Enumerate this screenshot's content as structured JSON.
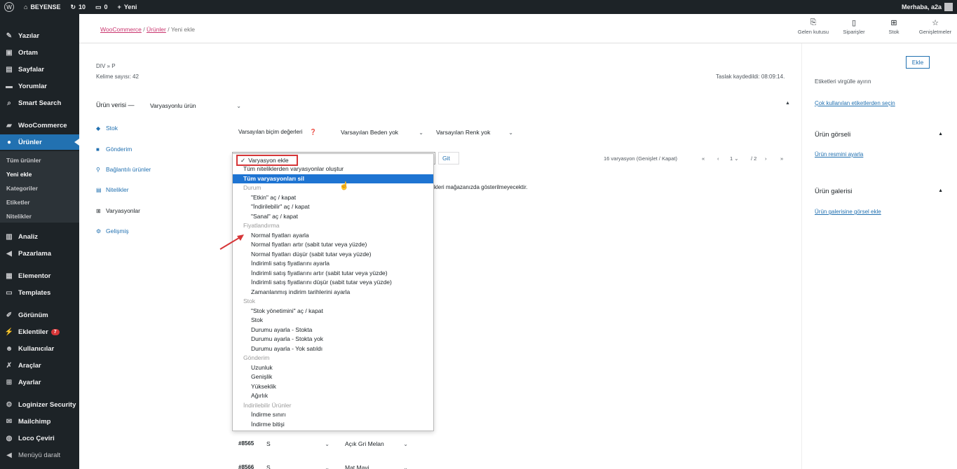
{
  "adminbar": {
    "site_name": "BEYENSE",
    "updates_count": "10",
    "comments_count": "0",
    "new_label": "Yeni",
    "greeting": "Merhaba, a2a"
  },
  "sidebar": {
    "items": [
      {
        "label": "Yazılar",
        "icon": "pin-icon"
      },
      {
        "label": "Ortam",
        "icon": "media-icon"
      },
      {
        "label": "Sayfalar",
        "icon": "page-icon"
      },
      {
        "label": "Yorumlar",
        "icon": "comment-icon"
      },
      {
        "label": "Smart Search",
        "icon": "search-icon"
      },
      {
        "label": "WooCommerce",
        "icon": "woo-icon"
      },
      {
        "label": "Ürünler",
        "icon": "products-icon"
      },
      {
        "label": "Analiz",
        "icon": "chart-icon"
      },
      {
        "label": "Pazarlama",
        "icon": "megaphone-icon"
      },
      {
        "label": "Elementor",
        "icon": "elementor-icon"
      },
      {
        "label": "Templates",
        "icon": "folder-icon"
      },
      {
        "label": "Görünüm",
        "icon": "brush-icon"
      },
      {
        "label": "Eklentiler",
        "icon": "plugin-icon",
        "badge": "7"
      },
      {
        "label": "Kullanıcılar",
        "icon": "user-icon"
      },
      {
        "label": "Araçlar",
        "icon": "wrench-icon"
      },
      {
        "label": "Ayarlar",
        "icon": "settings-icon"
      },
      {
        "label": "Loginizer Security",
        "icon": "gear-icon"
      },
      {
        "label": "Mailchimp",
        "icon": "mailchimp-icon"
      },
      {
        "label": "Loco Çeviri",
        "icon": "globe-icon"
      },
      {
        "label": "Menüyü daralt",
        "icon": "collapse-icon"
      }
    ],
    "submenu": [
      "Tüm ürünler",
      "Yeni ekle",
      "Kategoriler",
      "Etiketler",
      "Nitelikler"
    ]
  },
  "topbar": {
    "breadcrumb": [
      "WooCommerce",
      "Ürünler",
      "Yeni ekle"
    ],
    "actions": [
      {
        "label": "Gelen kutusu",
        "icon": "inbox-icon"
      },
      {
        "label": "Siparişler",
        "icon": "orders-icon"
      },
      {
        "label": "Stok",
        "icon": "stock-icon"
      },
      {
        "label": "Genişletmeler",
        "icon": "star-icon"
      }
    ]
  },
  "editor": {
    "path": "DIV » P",
    "word_count": "Kelime sayısı: 42",
    "draft_saved": "Taslak kaydedildi: 08:09:14."
  },
  "product_data": {
    "label": "Ürün verisi —",
    "type_value": "Varyasyonlu ürün",
    "default_values_label": "Varsayılan biçim değerleri",
    "default_size": "Varsayılan Beden yok",
    "default_color": "Varsayılan Renk yok",
    "go_button": "Git",
    "pagination": "16 varyasyon (Genişlet / Kapat)",
    "page_current": "1",
    "page_total": "/ 2",
    "notice_fragment": "kleri mağazanızda gösterilmeyecektir.",
    "tabs": [
      "Stok",
      "Gönderim",
      "Bağlantılı ürünler",
      "Nitelikler",
      "Varyasyonlar",
      "Gelişmiş"
    ],
    "variation_rows": [
      {
        "id": "#8565",
        "size": "S",
        "color": "Açık Gri Melan"
      },
      {
        "id": "#8566",
        "size": "S",
        "color": "Mat Mavi"
      }
    ]
  },
  "dropdown": {
    "selected": "Varyasyon ekle",
    "options": [
      {
        "text": "Tüm niteliklerden varyasyonlar oluştur",
        "kind": "option"
      },
      {
        "text": "Tüm varyasyonları sil",
        "kind": "highlight"
      },
      {
        "text": "Durum",
        "kind": "group"
      },
      {
        "text": "\"Etkin\" aç / kapat",
        "kind": "indent"
      },
      {
        "text": "\"İndirilebilir\" aç / kapat",
        "kind": "indent"
      },
      {
        "text": "\"Sanal\" aç / kapat",
        "kind": "indent"
      },
      {
        "text": "Fiyatlandırma",
        "kind": "group"
      },
      {
        "text": "Normal fiyatları ayarla",
        "kind": "indent"
      },
      {
        "text": "Normal fiyatları artır (sabit tutar veya yüzde)",
        "kind": "indent"
      },
      {
        "text": "Normal fiyatları düşür (sabit tutar veya yüzde)",
        "kind": "indent"
      },
      {
        "text": "İndirimli satış fiyatlarını ayarla",
        "kind": "indent"
      },
      {
        "text": "İndirimli satış fiyatlarını artır (sabit tutar veya yüzde)",
        "kind": "indent"
      },
      {
        "text": "İndirimli satış fiyatlarını düşür (sabit tutar veya yüzde)",
        "kind": "indent"
      },
      {
        "text": "Zamanlanmış indirim tarihlerini ayarla",
        "kind": "indent"
      },
      {
        "text": "Stok",
        "kind": "group"
      },
      {
        "text": "\"Stok yönetimini\" aç / kapat",
        "kind": "indent"
      },
      {
        "text": "Stok",
        "kind": "indent"
      },
      {
        "text": "Durumu ayarla - Stokta",
        "kind": "indent"
      },
      {
        "text": "Durumu ayarla - Stokta yok",
        "kind": "indent"
      },
      {
        "text": "Durumu ayarla - Yok satıldı",
        "kind": "indent"
      },
      {
        "text": "Gönderim",
        "kind": "group"
      },
      {
        "text": "Uzunluk",
        "kind": "indent"
      },
      {
        "text": "Genişlik",
        "kind": "indent"
      },
      {
        "text": "Yükseklik",
        "kind": "indent"
      },
      {
        "text": "Ağırlık",
        "kind": "indent"
      },
      {
        "text": "İndirilebilir Ürünler",
        "kind": "group"
      },
      {
        "text": "İndirme sınırı",
        "kind": "indent"
      },
      {
        "text": "İndirme bitişi",
        "kind": "indent"
      }
    ]
  },
  "rightcol": {
    "add_button": "Ekle",
    "tags_hint": "Etiketleri virgülle ayırın",
    "tags_link": "Çok kullanılan etiketlerden seçin",
    "image_title": "Ürün görseli",
    "image_link": "Ürün resmini ayarla",
    "gallery_title": "Ürün galerisi",
    "gallery_link": "Ürün galerisine görsel ekle"
  },
  "colors": {
    "admin_dark": "#1d2327",
    "accent_blue": "#2271b1",
    "highlight_blue": "#1e74d2",
    "annotation_red": "#d63638"
  }
}
